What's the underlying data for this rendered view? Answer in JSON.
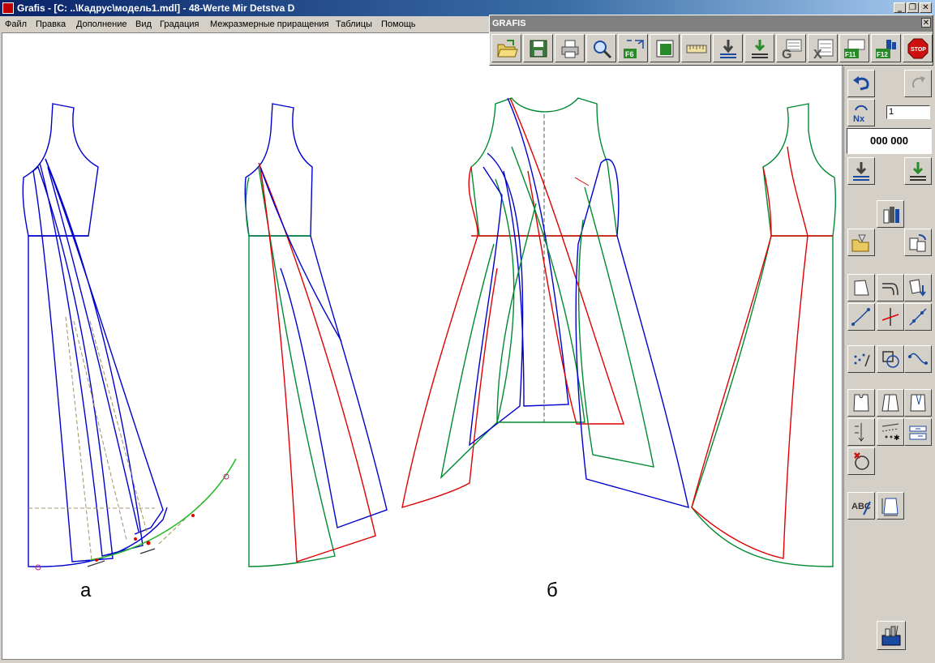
{
  "window": {
    "title": "Grafis - [C: ..\\Кадрус\\модель1.mdl] - 48-Werte Mir Detstva D"
  },
  "window_controls": {
    "minimize": "_",
    "restore": "❐",
    "close": "✕"
  },
  "menu": [
    "Файл",
    "Правка",
    "Дополнение",
    "Вид",
    "Градация",
    "Межразмерные приращения",
    "Таблицы",
    "Помощь"
  ],
  "toolbox": {
    "title": "GRAFIS",
    "close": "✕",
    "buttons": [
      "open-folder",
      "save",
      "print",
      "zoom",
      "f6-fit",
      "page-frame",
      "ruler-measure",
      "download-arrow",
      "download-green",
      "grading-g",
      "table-x",
      "f11-z",
      "f12-pieces",
      "stop"
    ],
    "f6_label": "F6",
    "f11_label": "F11",
    "f12_label": "F12",
    "stop_label": "STOP"
  },
  "right_panel": {
    "nx_label": "Nx",
    "nx_value": "1",
    "counter": "000 000",
    "abc_label": "ABC"
  },
  "canvas": {
    "label_a": "а",
    "label_b": "б"
  },
  "colors": {
    "pattern_blue": "#0000cc",
    "pattern_red": "#e00000",
    "pattern_green": "#008a30",
    "guide_olive": "#a09060",
    "bright_green": "#22bb22"
  }
}
